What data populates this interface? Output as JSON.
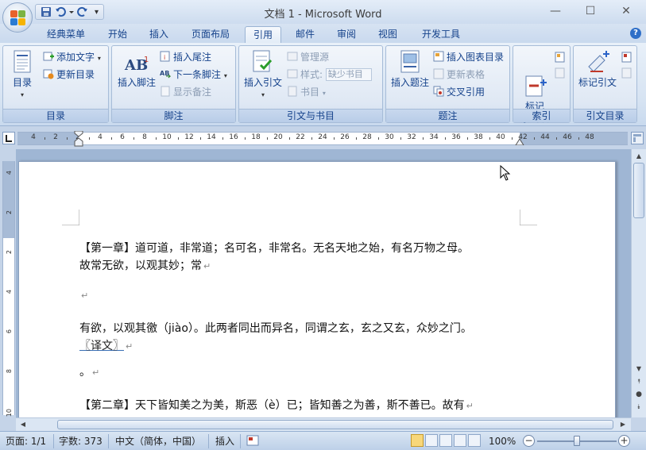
{
  "window": {
    "title": "文档 1 - Microsoft Word"
  },
  "tabs": [
    {
      "label": "经典菜单",
      "active": false
    },
    {
      "label": "开始",
      "active": false
    },
    {
      "label": "插入",
      "active": false
    },
    {
      "label": "页面布局",
      "active": false
    },
    {
      "label": "引用",
      "active": true
    },
    {
      "label": "邮件",
      "active": false
    },
    {
      "label": "审阅",
      "active": false
    },
    {
      "label": "视图",
      "active": false
    },
    {
      "label": "开发工具",
      "active": false
    }
  ],
  "ribbon": {
    "toc": {
      "label": "目录",
      "big": "目录",
      "add_text": "添加文字",
      "update_toc": "更新目录"
    },
    "footnotes": {
      "label": "脚注",
      "insert_footnote": "插入脚注",
      "insert_endnote": "插入尾注",
      "next_footnote": "下一条脚注",
      "show_notes": "显示备注"
    },
    "citations": {
      "label": "引文与书目",
      "insert_citation": "插入引文",
      "manage_sources": "管理源",
      "style_label": "样式:",
      "style_value": "缺少书目",
      "bibliography": "书目"
    },
    "captions": {
      "label": "题注",
      "insert_caption": "插入题注",
      "insert_tof": "插入图表目录",
      "update_table": "更新表格",
      "cross_ref": "交叉引用"
    },
    "index": {
      "label": "索引",
      "mark_entry": "标记\n索引项"
    },
    "toa": {
      "label": "引文目录",
      "mark_citation": "标记引文"
    }
  },
  "ruler": {
    "labels": [
      "4",
      "2",
      "2",
      "4",
      "6",
      "8",
      "10",
      "12",
      "14",
      "16",
      "18",
      "20",
      "22",
      "24",
      "26",
      "28",
      "30",
      "32",
      "34",
      "36",
      "38",
      "40",
      "42",
      "44",
      "46",
      "48"
    ],
    "vlabels": [
      "4",
      "2",
      "2",
      "4",
      "6",
      "8",
      "10"
    ]
  },
  "document": {
    "lines": [
      {
        "text": "【第一章】道可道，非常道；名可名，非常名。无名天地之始，有名万物之母。",
        "mark": ""
      },
      {
        "text": "故常无欲，以观其妙；常",
        "mark": "↵"
      },
      {
        "text": "",
        "mark": "↵"
      },
      {
        "text": "有欲，以观其徼（jiào）。此两者同出而异名，同谓之玄，玄之又玄，众妙之门。",
        "mark": ""
      },
      {
        "text": "〖译文〗",
        "mark": "↵"
      },
      {
        "text": "。",
        "mark": "↵"
      },
      {
        "text": "【第二章】天下皆知美之为美，斯恶（è）已；皆知善之为善，斯不善已。故有",
        "mark": "↵"
      }
    ]
  },
  "status": {
    "page": "页面: 1/1",
    "words": "字数: 373",
    "language": "中文（简体，中国）",
    "insert_mode": "插入",
    "zoom": "100%",
    "zoom_level": 0.5
  },
  "colors": {
    "accent": "#15428b",
    "ribbon_bg": "#dfe8f4",
    "page_bg": "#ffffff"
  }
}
